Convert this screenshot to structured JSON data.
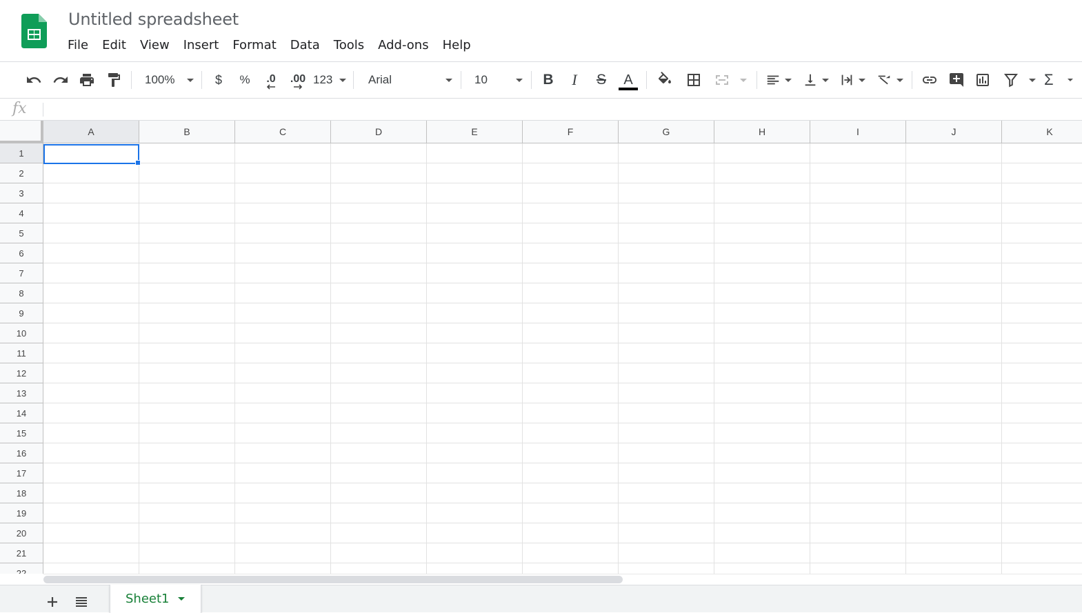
{
  "document": {
    "title": "Untitled spreadsheet"
  },
  "menu": [
    "File",
    "Edit",
    "View",
    "Insert",
    "Format",
    "Data",
    "Tools",
    "Add-ons",
    "Help"
  ],
  "toolbar": {
    "zoom": "100%",
    "currency": "$",
    "percent": "%",
    "decrease_decimal": ".0",
    "increase_decimal": ".00",
    "number_format": "123",
    "font": "Arial",
    "font_size": "10",
    "bold": "B",
    "italic": "I",
    "strikethrough": "S",
    "text_color": "A",
    "text_color_value": "#000000",
    "sum": "Σ"
  },
  "formula_bar": {
    "label": "fx",
    "value": ""
  },
  "columns": [
    "A",
    "B",
    "C",
    "D",
    "E",
    "F",
    "G",
    "H",
    "I",
    "J",
    "K"
  ],
  "rows": [
    "1",
    "2",
    "3",
    "4",
    "5",
    "6",
    "7",
    "8",
    "9",
    "10",
    "11",
    "12",
    "13",
    "14",
    "15",
    "16",
    "17",
    "18",
    "19",
    "20",
    "21",
    "22"
  ],
  "active_cell": "A1",
  "sheets": [
    {
      "name": "Sheet1",
      "active": true
    }
  ],
  "colors": {
    "brand_green": "#0f9d58",
    "selection_blue": "#1a73e8",
    "tab_green": "#188038"
  }
}
